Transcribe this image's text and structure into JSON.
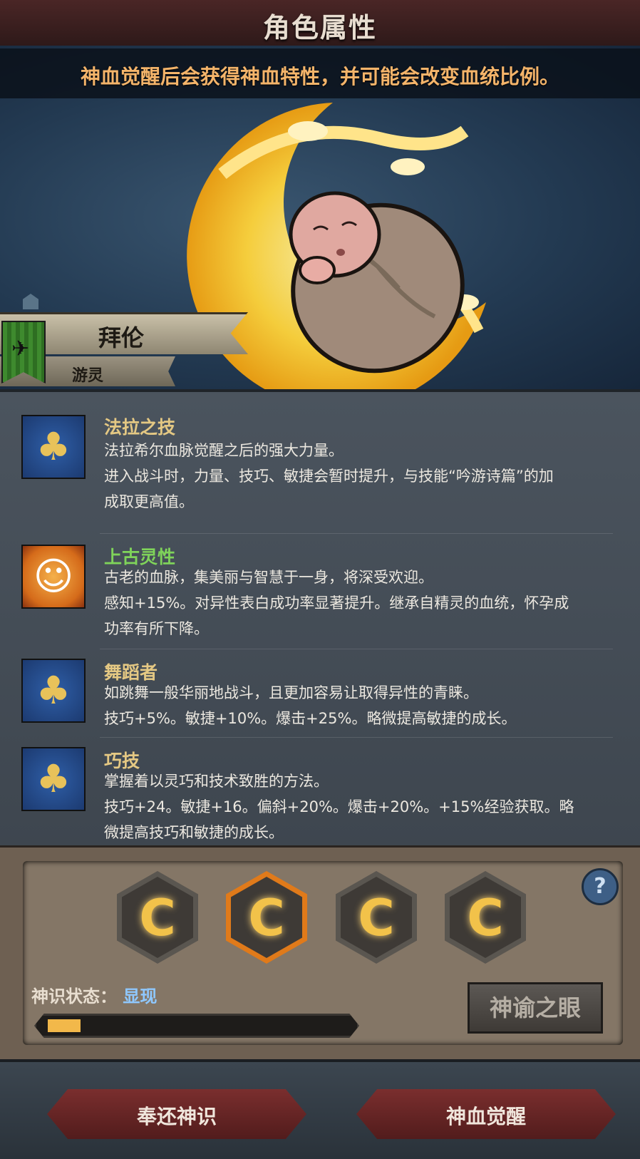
{
  "header": {
    "title": "角色属性"
  },
  "hero": {
    "notice": "神血觉醒后会获得神血特性，并可能会改变血统比例。",
    "name": "拜伦",
    "class_label": "游灵",
    "banner_icon": "crow-banner-icon"
  },
  "traits": [
    {
      "name": "法拉之技",
      "icon": "tree-icon",
      "lines": [
        "法拉希尔血脉觉醒之后的强大力量。",
        "进入战斗时，力量、技巧、敏捷会暂时提升，与技能“吟游诗篇”的加",
        "成取更高值。"
      ]
    },
    {
      "name": "上古灵性",
      "icon": "smiling-sun-icon",
      "lines": [
        "古老的血脉，集美丽与智慧于一身，将深受欢迎。",
        "感知+15%。对异性表白成功率显著提升。继承自精灵的血统，怀孕成",
        "功率有所下降。"
      ]
    },
    {
      "name": "舞蹈者",
      "icon": "tree-icon",
      "lines": [
        "如跳舞一般华丽地战斗，且更加容易让取得异性的青睐。",
        "技巧+5%。敏捷+10%。爆击+25%。略微提高敏捷的成长。"
      ]
    },
    {
      "name": "巧技",
      "icon": "tree-icon",
      "lines": [
        "掌握着以灵巧和技术致胜的方法。",
        "技巧+24。敏捷+16。偏斜+20%。爆击+20%。+15%经验获取。略",
        "微提高技巧和敏捷的成长。"
      ]
    }
  ],
  "awakening": {
    "slots": [
      {
        "active": false
      },
      {
        "active": true
      },
      {
        "active": false
      },
      {
        "active": false
      }
    ],
    "status_label": "神识状态：",
    "status_value": "显现",
    "progress": 0.11,
    "eye_button": "神谕之眼"
  },
  "footer": {
    "return_button": "奉还神识",
    "awaken_button": "神血觉醒"
  },
  "colors": {
    "accent": "#f2b84a",
    "trait_name": "#e4c883",
    "trait_name_special": "#7fd35a",
    "status_value": "#8fc8ff"
  }
}
